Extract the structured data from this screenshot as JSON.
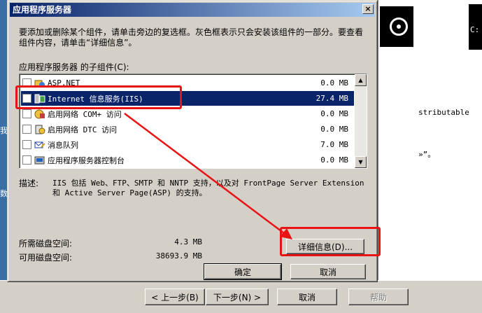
{
  "background": {
    "right_text_1": "stributable",
    "right_text_2": "»”。",
    "term_text": "C:",
    "left_chars": [
      "我",
      "数"
    ],
    "buttons": {
      "back": "< 上一步(B)",
      "next": "下一步(N) >",
      "cancel": "取消",
      "help": "帮助"
    }
  },
  "dialog": {
    "title": "应用程序服务器",
    "close_label": "×",
    "description": "要添加或删除某个组件，请单击旁边的复选框。灰色框表示只会安装该组件的一部分。要查看组件内容，请单击“详细信息”。",
    "subcomponents_label": "应用程序服务器 的子组件(C):",
    "components": [
      {
        "name": "ASP.NET",
        "size": "0.0 MB",
        "selected": false,
        "icon": "aspnet-icon"
      },
      {
        "name": "Internet 信息服务(IIS)",
        "size": "27.4 MB",
        "selected": true,
        "icon": "iis-icon"
      },
      {
        "name": "启用网络 COM+ 访问",
        "size": "0.0 MB",
        "selected": false,
        "icon": "com-plus-icon"
      },
      {
        "name": "启用网络 DTC 访问",
        "size": "0.0 MB",
        "selected": false,
        "icon": "dtc-icon"
      },
      {
        "name": "消息队列",
        "size": "7.0 MB",
        "selected": false,
        "icon": "message-queue-icon"
      },
      {
        "name": "应用程序服务器控制台",
        "size": "0.0 MB",
        "selected": false,
        "icon": "console-icon"
      }
    ],
    "detail_label": "描述:",
    "detail_text": "IIS 包括 Web、FTP、SMTP 和 NNTP 支持，以及对 FrontPage Server Extension 和 Active Server Page(ASP) 的支持。",
    "required_space_label": "所需磁盘空间:",
    "required_space_value": "4.3 MB",
    "available_space_label": "可用磁盘空间:",
    "available_space_value": "38693.9 MB",
    "details_button": "详细信息(D)...",
    "ok_button": "确定",
    "cancel_button": "取消"
  },
  "colors": {
    "highlight": "#e81313",
    "selection": "#0a246a",
    "face": "#d4d0c8"
  }
}
